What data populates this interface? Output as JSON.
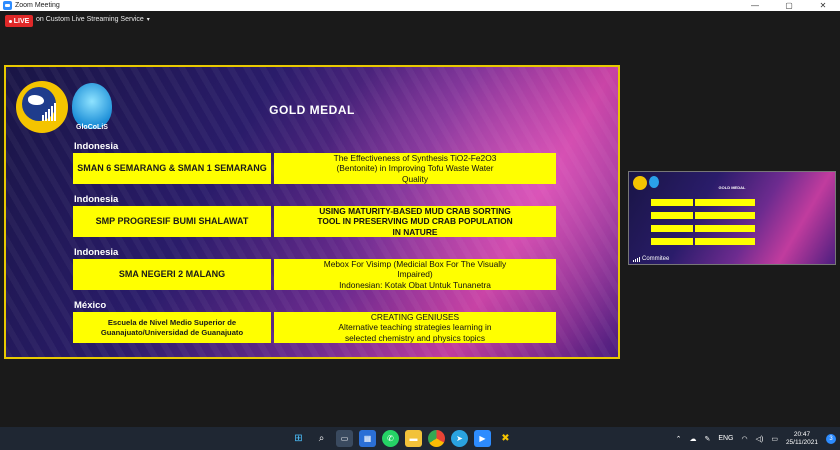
{
  "window": {
    "title": "Zoom Meeting",
    "controls": [
      "—",
      "▢",
      "✕"
    ]
  },
  "toolbar": {
    "live_label": "LIVE",
    "stream_text": "on Custom Live Streaming Service",
    "dropdown_glyph": "▾"
  },
  "slide": {
    "logo_text": "GloCoLiS",
    "title": "GOLD MEDAL",
    "entries": [
      {
        "country": "Indonesia",
        "school": "SMAN 6 SEMARANG & SMAN 1 SEMARANG",
        "project": [
          "The Effectiveness of Synthesis TiO2-Fe2O3",
          "(Bentonite) in Improving Tofu Waste Water",
          "Quality"
        ]
      },
      {
        "country": "Indonesia",
        "school": "SMP PROGRESIF BUMI SHALAWAT",
        "project": [
          "USING MATURITY-BASED MUD CRAB SORTING",
          "TOOL IN PRESERVING MUD CRAB POPULATION",
          "IN NATURE"
        ]
      },
      {
        "country": "Indonesia",
        "school": "SMA NEGERI 2 MALANG",
        "project": [
          "Mebox For Visimp (Medicial Box For The Visually",
          "Impaired)",
          "Indonesian: Kotak Obat Untuk Tunanetra"
        ]
      },
      {
        "country": "México",
        "school": "Escuela de Nivel Medio Superior de Guanajuato/Universidad de Guanajuato",
        "project": [
          "CREATING GENIUSES",
          "Alternative teaching strategies learning in",
          "selected chemistry and physics topics"
        ]
      }
    ]
  },
  "thumbnail": {
    "title": "GOLD MEDAL",
    "participant_name": "Commitee"
  },
  "taskbar": {
    "language": "ENG",
    "time": "20:47",
    "date": "25/11/2021",
    "notifications": "3",
    "apps": [
      "windows-icon",
      "search-icon",
      "file-explorer-icon",
      "store-icon",
      "whatsapp-icon",
      "folder-icon",
      "chrome-icon",
      "telegram-icon",
      "zoom-icon",
      "tools-icon"
    ]
  },
  "colors": {
    "live_badge": "#e02828",
    "slide_border": "#e8c900",
    "box_fill": "#ffff00",
    "zoom_blue": "#2d8cff"
  }
}
